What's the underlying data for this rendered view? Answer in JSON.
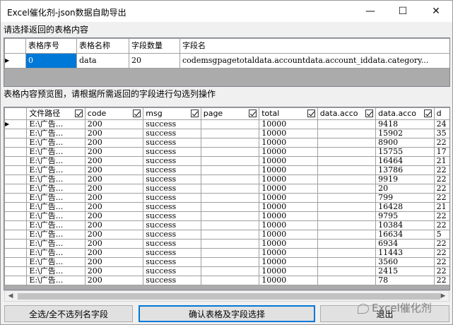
{
  "window": {
    "title": "Excel催化剂-json数据自助导出",
    "min_glyph": "—",
    "max_glyph": "☐",
    "close_glyph": "✕"
  },
  "labels": {
    "select_table": "请选择返回的表格内容",
    "preview": "表格内容预览图，请根据所需返回的字段进行勾选列操作"
  },
  "table_grid": {
    "columns": [
      "表格序号",
      "表格名称",
      "字段数量",
      "字段名"
    ],
    "row": {
      "index": "0",
      "name": "data",
      "count": "20",
      "fields": "codemsgpagetotaldata.accountdata.account_iddata.category..."
    }
  },
  "preview_grid": {
    "columns": [
      "文件路径",
      "code",
      "msg",
      "page",
      "total",
      "data.acco",
      "data.acco",
      "d"
    ],
    "rows": [
      [
        "E:\\广告...",
        "200",
        "success",
        "",
        "10000",
        "",
        "9418",
        "24"
      ],
      [
        "E:\\广告...",
        "200",
        "success",
        "",
        "10000",
        "",
        "15902",
        "35"
      ],
      [
        "E:\\广告...",
        "200",
        "success",
        "",
        "10000",
        "",
        "8900",
        "22"
      ],
      [
        "E:\\广告...",
        "200",
        "success",
        "",
        "10000",
        "",
        "15755",
        "17"
      ],
      [
        "E:\\广告...",
        "200",
        "success",
        "",
        "10000",
        "",
        "16464",
        "21"
      ],
      [
        "E:\\广告...",
        "200",
        "success",
        "",
        "10000",
        "",
        "13786",
        "22"
      ],
      [
        "E:\\广告...",
        "200",
        "success",
        "",
        "10000",
        "",
        "9919",
        "22"
      ],
      [
        "E:\\广告...",
        "200",
        "success",
        "",
        "10000",
        "",
        "20",
        "22"
      ],
      [
        "E:\\广告...",
        "200",
        "success",
        "",
        "10000",
        "",
        "799",
        "22"
      ],
      [
        "E:\\广告...",
        "200",
        "success",
        "",
        "10000",
        "",
        "16428",
        "21"
      ],
      [
        "E:\\广告...",
        "200",
        "success",
        "",
        "10000",
        "",
        "9795",
        "22"
      ],
      [
        "E:\\广告...",
        "200",
        "success",
        "",
        "10000",
        "",
        "10384",
        "22"
      ],
      [
        "E:\\广告...",
        "200",
        "success",
        "",
        "10000",
        "",
        "16634",
        "5"
      ],
      [
        "E:\\广告...",
        "200",
        "success",
        "",
        "10000",
        "",
        "6934",
        "22"
      ],
      [
        "E:\\广告...",
        "200",
        "success",
        "",
        "10000",
        "",
        "11443",
        "22"
      ],
      [
        "E:\\广告...",
        "200",
        "success",
        "",
        "10000",
        "",
        "3560",
        "22"
      ],
      [
        "E:\\广告...",
        "200",
        "success",
        "",
        "10000",
        "",
        "2415",
        "22"
      ],
      [
        "E:\\广告...",
        "200",
        "success",
        "",
        "10000",
        "",
        "78",
        "22"
      ]
    ]
  },
  "buttons": {
    "select_all": "全选/全不选列名字段",
    "confirm": "确认表格及字段选择",
    "exit": "退出"
  },
  "watermark": "Excel催化剂",
  "row_indicator": "▶",
  "scroll": {
    "left": "◀",
    "right": "▶"
  }
}
